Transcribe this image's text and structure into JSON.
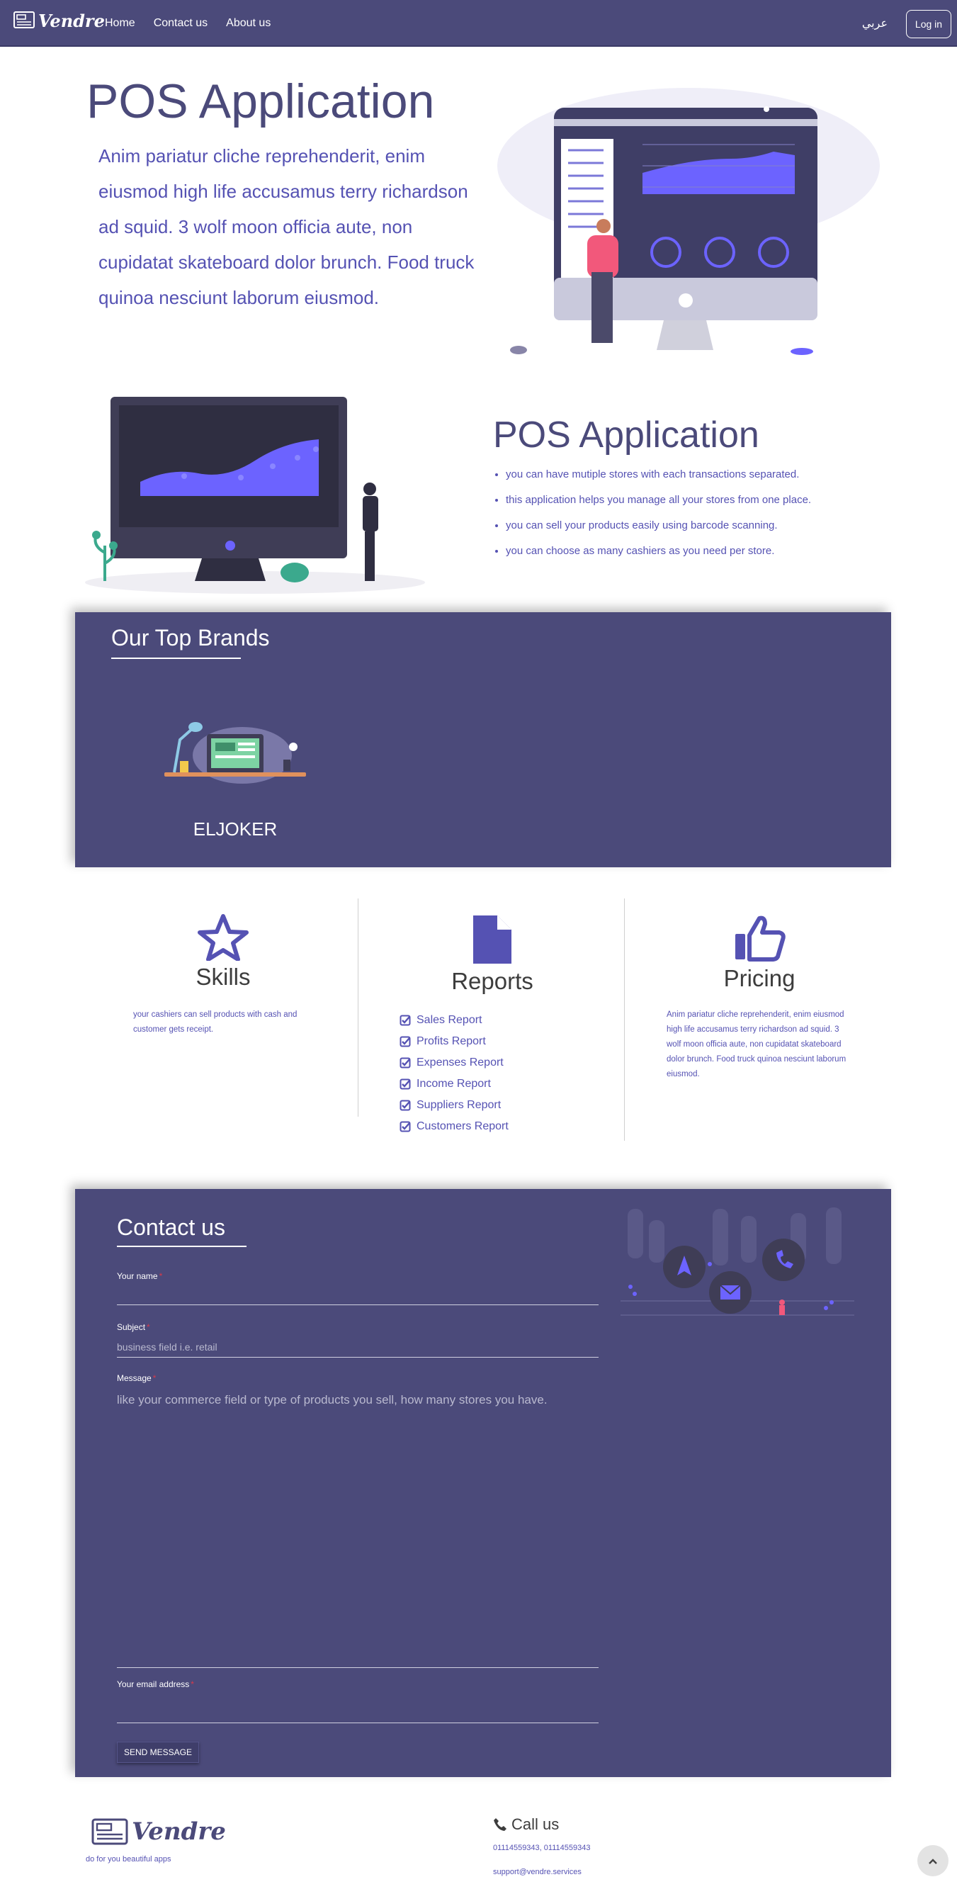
{
  "nav": {
    "brand": "Vendre",
    "links": [
      "Home",
      "Contact us",
      "About us"
    ],
    "lang": "عربي",
    "login": "Log in"
  },
  "hero": {
    "title": "POS Application",
    "desc": "Anim pariatur cliche reprehenderit, enim eiusmod high life accusamus terry richardson ad squid. 3 wolf moon officia aute, non cupidatat skateboard dolor brunch. Food truck quinoa nesciunt laborum eiusmod."
  },
  "feature2": {
    "title": "POS Application",
    "bullets": [
      "you can have mutiple stores with each transactions separated.",
      "this application helps you manage all your stores from one place.",
      "you can sell your products easily using barcode scanning.",
      "you can choose as many cashiers as you need per store."
    ]
  },
  "brands": {
    "title": "Our Top Brands",
    "items": [
      {
        "name": "ELJOKER"
      }
    ]
  },
  "features": {
    "skills": {
      "title": "Skills",
      "desc": "your cashiers can sell products with cash and customer gets receipt."
    },
    "reports": {
      "title": "Reports",
      "items": [
        "Sales Report",
        "Profits Report",
        "Expenses Report",
        "Income Report",
        "Suppliers Report",
        "Customers Report"
      ]
    },
    "pricing": {
      "title": "Pricing",
      "desc": "Anim pariatur cliche reprehenderit, enim eiusmod high life accusamus terry richardson ad squid. 3 wolf moon officia aute, non cupidatat skateboard dolor brunch. Food truck quinoa nesciunt laborum eiusmod."
    }
  },
  "contact": {
    "title": "Contact us",
    "name_label": "Your name",
    "subject_label": "Subject",
    "subject_placeholder": "business field i.e. retail",
    "message_label": "Message",
    "message_placeholder": "like your commerce field or type of products you sell, how many stores you have.",
    "email_label": "Your email address",
    "required_mark": "*",
    "send": "SEND MESSAGE"
  },
  "footer": {
    "brand": "Vendre",
    "tagline": "do for you beautiful apps",
    "call_title": "Call us",
    "phones": "01114559343, 01114559343",
    "email": "support@vendre.services"
  },
  "colors": {
    "primary": "#4b4a7a",
    "accent": "#5552b3",
    "white": "#ffffff"
  }
}
